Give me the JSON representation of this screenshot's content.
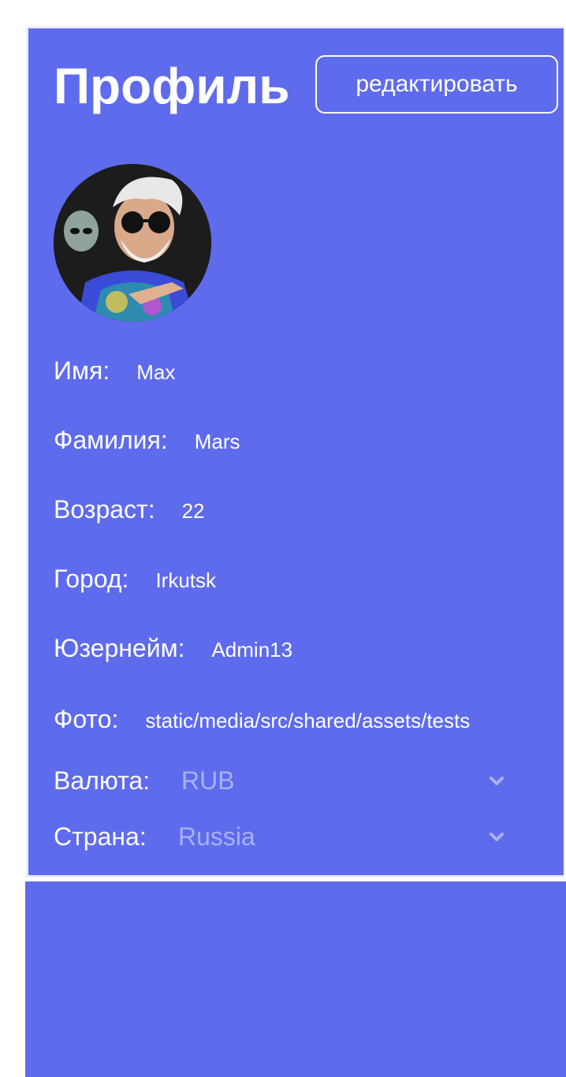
{
  "profile": {
    "title": "Профиль",
    "edit_label": "редактировать",
    "fields": [
      {
        "label": "Имя:",
        "value": "Max"
      },
      {
        "label": "Фамилия:",
        "value": "Mars"
      },
      {
        "label": "Возраст:",
        "value": "22"
      },
      {
        "label": "Город:",
        "value": "Irkutsk"
      },
      {
        "label": "Юзернейм:",
        "value": "Admin13"
      },
      {
        "label": "Фото:",
        "value": "static/media/src/shared/assets/tests"
      }
    ],
    "currency": {
      "label": "Валюта:",
      "value": "RUB",
      "icon": "chevron-down-icon"
    },
    "country": {
      "label": "Страна:",
      "value": "Russia",
      "icon": "chevron-down-icon"
    }
  },
  "colors": {
    "card_bg": "#5f6bed",
    "select_text": "#a8b0f5",
    "text": "#ffffff"
  }
}
